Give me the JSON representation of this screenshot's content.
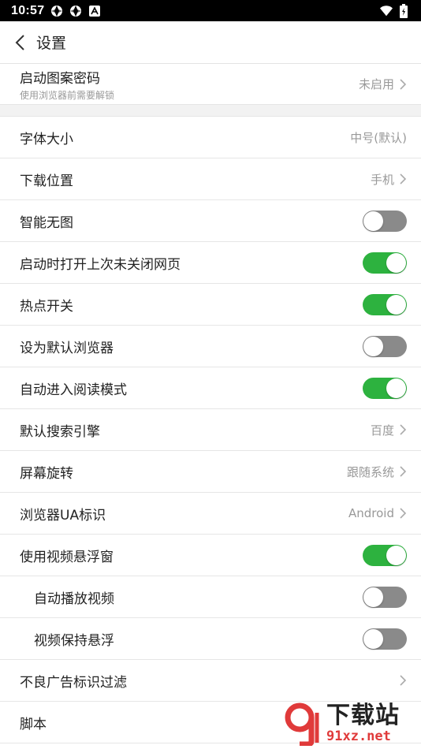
{
  "status_bar": {
    "time": "10:57"
  },
  "header": {
    "title": "设置"
  },
  "rows": [
    {
      "label": "启动图案密码",
      "sublabel": "使用浏览器前需要解锁",
      "value": "未启用"
    },
    {
      "label": "字体大小",
      "value": "中号(默认)"
    },
    {
      "label": "下载位置",
      "value": "手机"
    },
    {
      "label": "智能无图",
      "toggle": "off"
    },
    {
      "label": "启动时打开上次未关闭网页",
      "toggle": "on"
    },
    {
      "label": "热点开关",
      "toggle": "on"
    },
    {
      "label": "设为默认浏览器",
      "toggle": "off"
    },
    {
      "label": "自动进入阅读模式",
      "toggle": "on"
    },
    {
      "label": "默认搜索引擎",
      "value": "百度"
    },
    {
      "label": "屏幕旋转",
      "value": "跟随系统"
    },
    {
      "label": "浏览器UA标识",
      "value": "Android"
    },
    {
      "label": "使用视频悬浮窗",
      "toggle": "on"
    },
    {
      "label": "自动播放视频",
      "toggle": "off"
    },
    {
      "label": "视频保持悬浮",
      "toggle": "off"
    },
    {
      "label": "不良广告标识过滤"
    },
    {
      "label": "脚本"
    }
  ],
  "watermark": {
    "text": "下载站",
    "url": "91xz.net"
  },
  "colors": {
    "toggle_on": "#2db23f",
    "toggle_off": "#8a8a8a",
    "watermark_red": "#e03a3a"
  }
}
